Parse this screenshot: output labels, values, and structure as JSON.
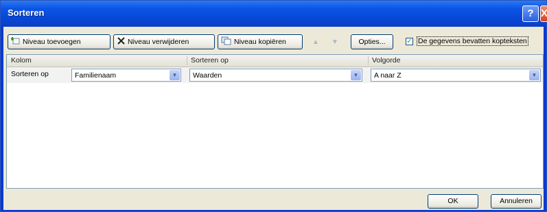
{
  "window": {
    "title": "Sorteren",
    "help_label": "?",
    "close_label": "X"
  },
  "toolbar": {
    "add_level": "Niveau toevoegen",
    "delete_level": "Niveau verwijderen",
    "copy_level": "Niveau kopiëren",
    "move_up": "▲",
    "move_down": "▼",
    "options": "Opties...",
    "has_headers_label": "De gegevens bevatten kopteksten",
    "has_headers_checked": "✓"
  },
  "grid": {
    "headers": {
      "column": "Kolom",
      "sort_on": "Sorteren op",
      "order": "Volgorde"
    },
    "rows": [
      {
        "label": "Sorteren op",
        "column": "Familienaam",
        "sort_on": "Waarden",
        "order": "A naar Z"
      }
    ]
  },
  "buttons": {
    "ok": "OK",
    "cancel": "Annuleren"
  },
  "icons": {
    "add": "add-level-icon",
    "delete": "delete-x-icon",
    "copy": "copy-icon",
    "dropdown": "chevron-down-icon"
  },
  "colors": {
    "titlebar": "#0a55e6",
    "dialog_bg": "#ece9d8",
    "close_button": "#d9401c"
  }
}
